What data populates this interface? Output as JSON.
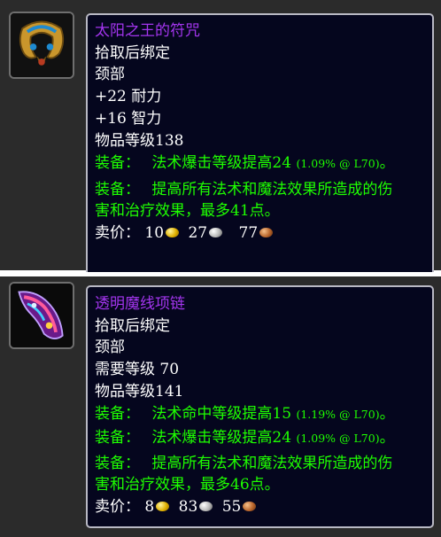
{
  "items": [
    {
      "name": "太阳之王的符咒",
      "bind": "拾取后绑定",
      "slot": "颈部",
      "stats": [
        "+22 耐力",
        "+16 智力"
      ],
      "required_level": "",
      "item_level": "物品等级138",
      "equips": [
        {
          "label": "装备：",
          "text": "法术爆击等级提高24",
          "pct": "(1.09% @ L70)",
          "tail": "。"
        },
        {
          "label": "装备：",
          "text": "提高所有法术和魔法效果所造成的伤",
          "cont": "害和治疗效果，最多41点。"
        }
      ],
      "sell": {
        "label": "卖价：",
        "gold": "10",
        "silver": "27",
        "copper": "77"
      },
      "icon": "amulet-icon"
    },
    {
      "name": "透明魔线项链",
      "bind": "拾取后绑定",
      "slot": "颈部",
      "stats": [],
      "required_level": "需要等级 70",
      "item_level": "物品等级141",
      "equips": [
        {
          "label": "装备：",
          "text": "法术命中等级提高15",
          "pct": "(1.19% @ L70)",
          "tail": "。"
        },
        {
          "label": "装备：",
          "text": "法术爆击等级提高24",
          "pct": "(1.09% @ L70)",
          "tail": "。"
        },
        {
          "label": "装备：",
          "text": "提高所有法术和魔法效果所造成的伤",
          "cont": "害和治疗效果，最多46点。"
        }
      ],
      "sell": {
        "label": "卖价：",
        "gold": "8",
        "silver": "83",
        "copper": "55"
      },
      "icon": "necklace-icon"
    }
  ],
  "colors": {
    "epic": "#a335ee",
    "equip": "#1eff00",
    "bg": "#05061e"
  }
}
